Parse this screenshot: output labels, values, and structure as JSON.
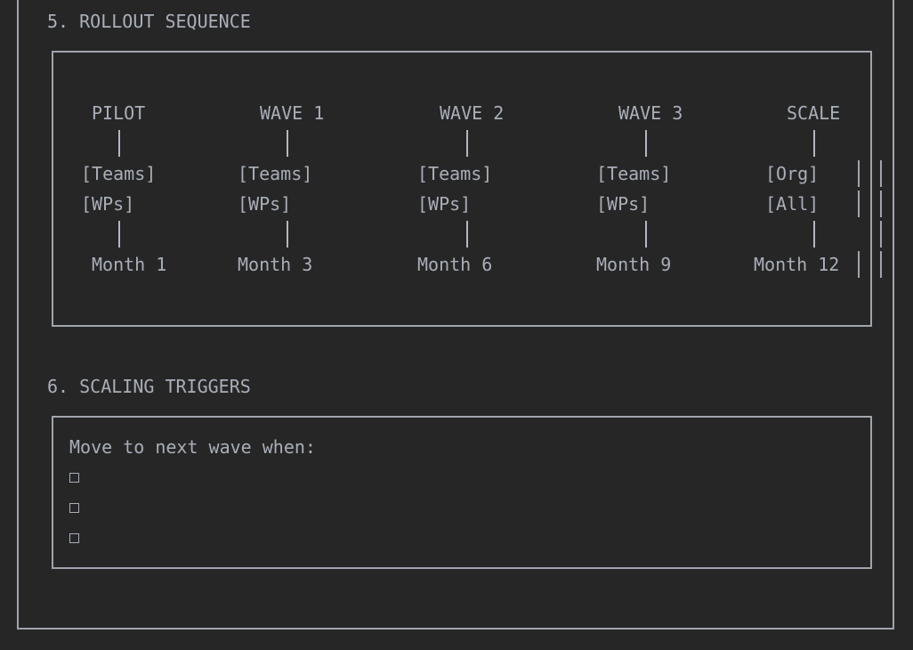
{
  "section_rollout": {
    "heading": "5. ROLLOUT SEQUENCE",
    "phases": [
      {
        "name": "PILOT",
        "scope": "[Teams]",
        "work": "[WPs]",
        "timing": "Month 1"
      },
      {
        "name": "WAVE 1",
        "scope": "[Teams]",
        "work": "[WPs]",
        "timing": "Month 3"
      },
      {
        "name": "WAVE 2",
        "scope": "[Teams]",
        "work": "[WPs]",
        "timing": "Month 6"
      },
      {
        "name": "WAVE 3",
        "scope": "[Teams]",
        "work": "[WPs]",
        "timing": "Month 9"
      },
      {
        "name": "SCALE",
        "scope": "[Org]",
        "work": "[All]",
        "timing": "Month 12"
      }
    ]
  },
  "section_triggers": {
    "heading": "6. SCALING TRIGGERS",
    "intro": "Move to next wave when:",
    "checkbox_glyph": "□",
    "criteria_count": 3
  },
  "colors": {
    "background": "#262626",
    "text": "#a9aeb8",
    "border": "#a0a4ad"
  }
}
